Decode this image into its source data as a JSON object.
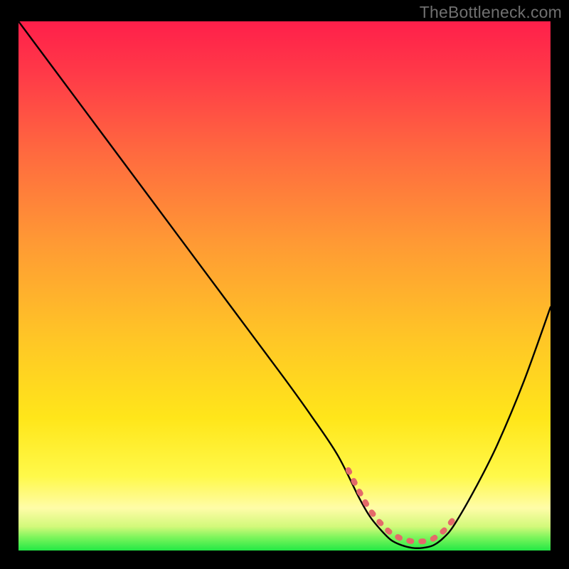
{
  "attribution": "TheBottleneck.com",
  "colors": {
    "top": "#ff1f4a",
    "mid": "#ffd400",
    "yellow_pale": "#fffb9a",
    "green": "#2cf04b",
    "curve": "#000000",
    "marker": "#e46a6a",
    "background": "#000000"
  },
  "chart_data": {
    "type": "line",
    "title": "",
    "xlabel": "",
    "ylabel": "",
    "xlim": [
      0,
      100
    ],
    "ylim": [
      0,
      100
    ],
    "grid": false,
    "legend": false,
    "curve_description": "Bottleneck curve: falls from top-left, reaches a flat minimum near x≈65–80, then rises toward the right edge.",
    "series": [
      {
        "name": "bottleneck-curve",
        "x": [
          0,
          10,
          20,
          30,
          40,
          50,
          55,
          60,
          64,
          66,
          68,
          70,
          72,
          74,
          76,
          78,
          80,
          82,
          86,
          90,
          95,
          100
        ],
        "y": [
          100,
          86.5,
          73,
          59.5,
          46,
          32.5,
          25.5,
          18,
          10,
          6.5,
          4,
          2,
          1,
          0.5,
          0.5,
          1,
          2.5,
          5,
          12,
          20,
          32,
          46
        ]
      }
    ],
    "marker_band": {
      "description": "Red markers along the minimum plateau of the curve",
      "x_range": [
        62,
        82
      ],
      "y_approx": [
        8,
        1,
        8
      ]
    }
  }
}
